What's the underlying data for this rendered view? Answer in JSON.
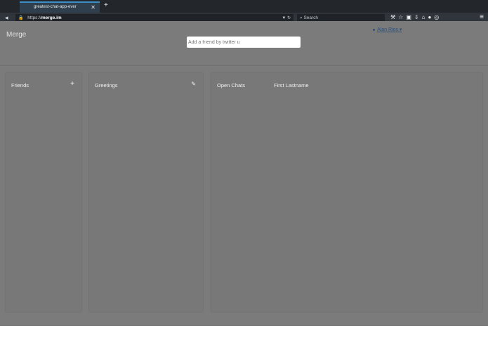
{
  "browser": {
    "tab_title": "greatest-chat-app-ever",
    "new_tab_label": "+",
    "url_prefix": "https://",
    "url_host": "merge.im",
    "search_placeholder": "Search"
  },
  "app": {
    "brand": "Merge",
    "user_name": "Alan Rios",
    "add_friend_placeholder": "Add a friend by twitter u"
  },
  "panels": {
    "friends": {
      "title": "Friends",
      "icon": "plus-icon"
    },
    "greetings": {
      "title": "Greetings",
      "icon": "edit-icon"
    },
    "chats": {
      "title": "Open Chats",
      "header": "First Lastname"
    }
  }
}
